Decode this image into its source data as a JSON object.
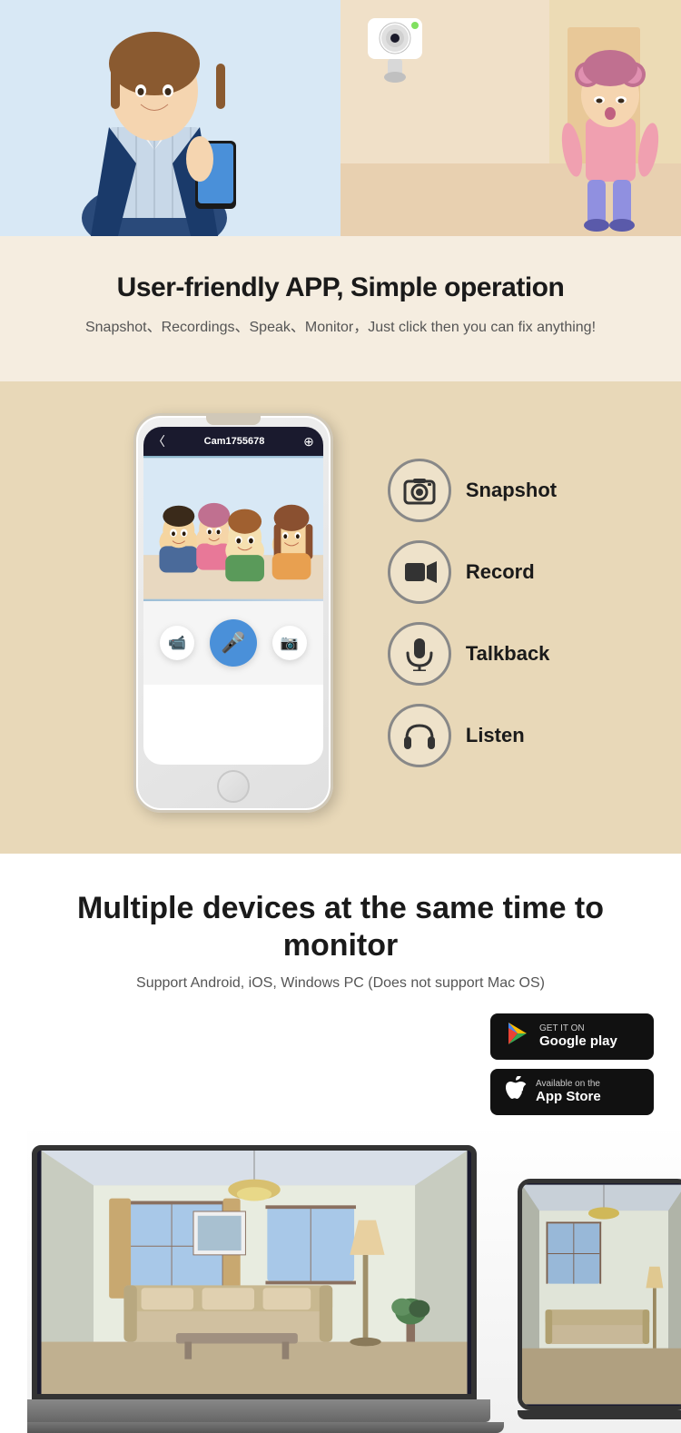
{
  "top_section": {
    "left_photo_alt": "Woman smiling with phone",
    "right_photo_alt": "Security camera monitoring child"
  },
  "app_features_banner": {
    "title": "User-friendly APP, Simple operation",
    "subtitle": "Snapshot、Recordings、Speak、Monitor，Just click then you can fix anything!"
  },
  "phone_app": {
    "header_back": "〈",
    "header_title": "Cam1755678",
    "header_icon": "⊕"
  },
  "features": [
    {
      "id": "snapshot",
      "icon": "📷",
      "label": "Snapshot"
    },
    {
      "id": "record",
      "icon": "📹",
      "label": "Record"
    },
    {
      "id": "talkback",
      "icon": "🎤",
      "label": "Talkback"
    },
    {
      "id": "listen",
      "icon": "🎧",
      "label": "Listen"
    }
  ],
  "devices_section": {
    "title": "Multiple devices at the same time to monitor",
    "subtitle": "Support Android, iOS, Windows PC (Does not support Mac OS)",
    "google_play_small": "GET IT ON",
    "google_play_big": "Google play",
    "app_store_small": "Available on the",
    "app_store_big": "App Store"
  }
}
